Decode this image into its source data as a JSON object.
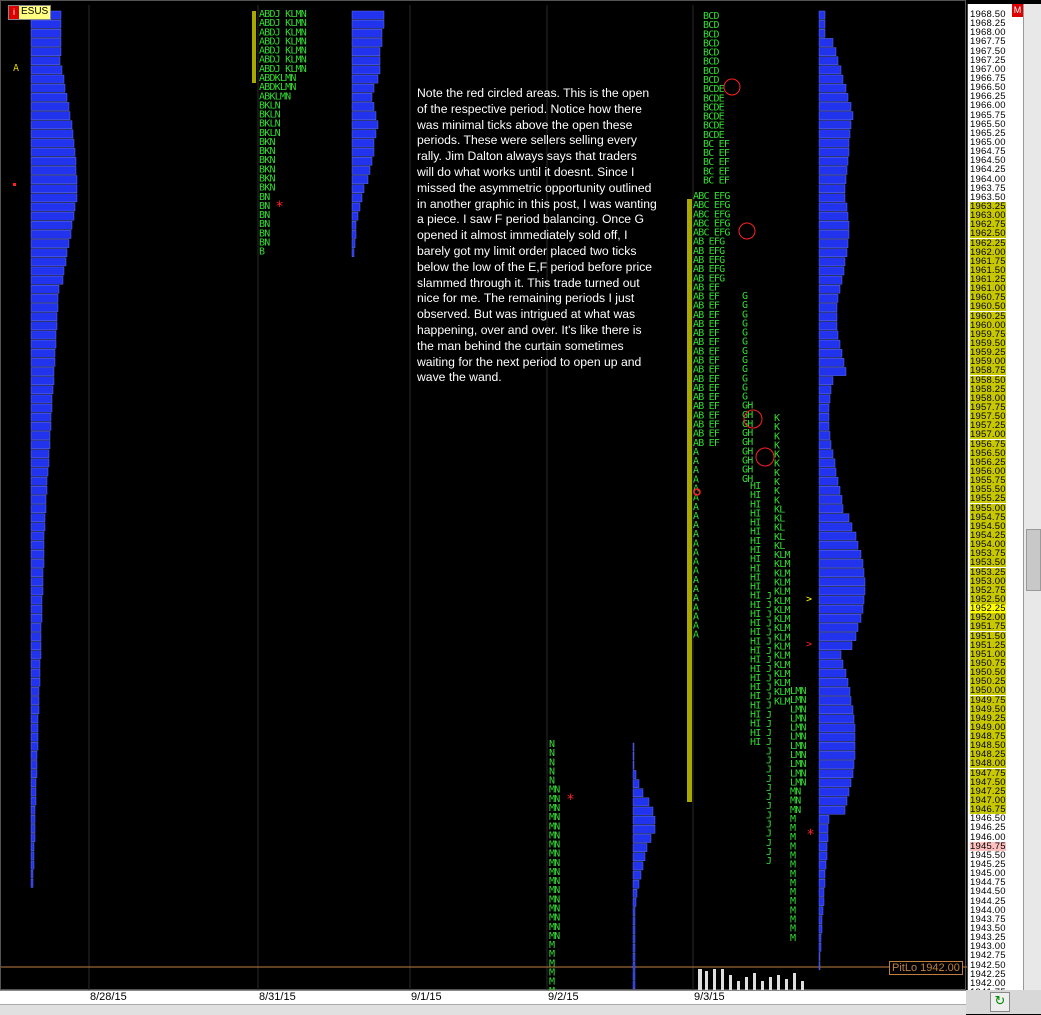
{
  "symbol": "ESUS",
  "window_icon": "i",
  "menu_button": "M",
  "pitlo_label": "PitLo 1942.00",
  "dates": [
    "8/28/15",
    "8/31/15",
    "9/1/15",
    "9/2/15",
    "9/3/15"
  ],
  "note": "Note the red circled areas. This is the open of the respective period. Notice how there was minimal ticks above the open these periods. These were sellers selling every rally. Jim Dalton always says that traders will do what works until it doesnt. Since I missed the asymmetric opportunity outlined in another graphic in this post, I was wanting a piece. I saw F period balancing. Once G opened it almost immediately sold off, I barely got my limit order placed two ticks below the low of the E,F period before price slammed through it. This trade turned out nice for me. The remaining periods I just observed. But was intrigued at what was happening, over and over. It's like there is the man behind the curtain sometimes waiting for the next period to open up and wave the wand.",
  "price_scale": {
    "max": 1968.5,
    "min": 1941.75,
    "step": 0.25,
    "current_price": "1952.25",
    "highlight_range": [
      1946.75,
      1963.25
    ],
    "pink_price": "1945.75"
  },
  "colors": {
    "tpo_letter": "#33dd33",
    "profile_bar": "#2233ee",
    "value_area": "#a8a800",
    "open_marker": "#ff2222",
    "background": "#000000"
  },
  "sessions": [
    {
      "date": "8/28/15",
      "rows_top": "1968.50",
      "rows_bottom": "1942.75"
    },
    {
      "date": "8/31/15",
      "rows": [
        "ABDJ KLMN",
        "ABDJ KLMN",
        "ABDJ KLMN",
        "ABDJ KLMN",
        "ABDJ KLMN",
        "ABDJ KLMN",
        "ABDJ KLMN",
        "ABDKLMN",
        "ABDKLMN",
        "ABKLMN",
        "BKLN",
        "BKLN",
        "BKLN",
        "BKLN",
        "BKN",
        "BKN",
        "BKN",
        "BKN",
        "BKN",
        "BKN",
        "BN",
        "BN",
        "BN",
        "BN",
        "BN",
        "BN",
        "B"
      ]
    },
    {
      "date": "9/2/15",
      "rows": [
        "N",
        "N",
        "N",
        "N",
        "N",
        "MN",
        "MN",
        "MN",
        "MN",
        "MN",
        "MN",
        "MN",
        "MN",
        "MN",
        "MN",
        "MN",
        "MN",
        "MN",
        "MN",
        "MN",
        "MN",
        "MN",
        "M",
        "M",
        "M",
        "M",
        "M",
        "M",
        "M",
        "M",
        "M"
      ]
    },
    {
      "date": "9/3/15",
      "note": "periods A–N"
    }
  ]
}
